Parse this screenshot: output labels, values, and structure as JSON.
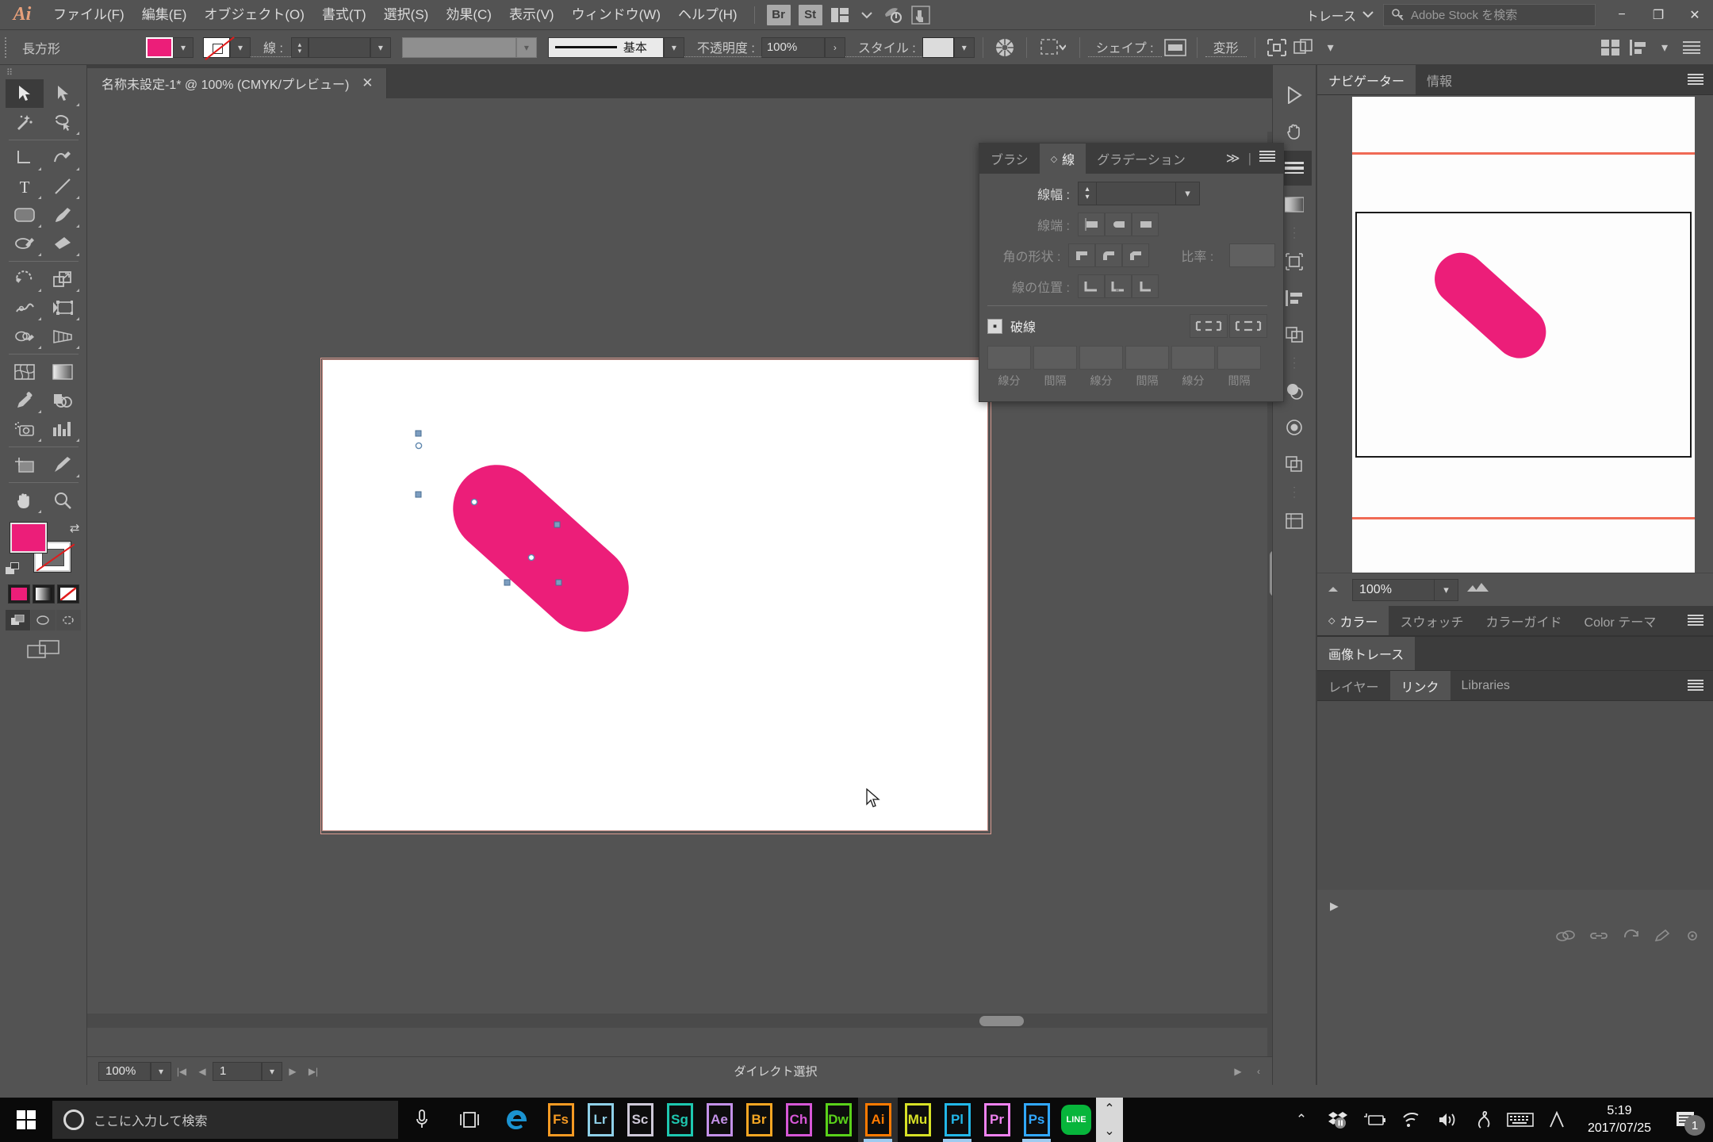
{
  "app": {
    "name": "Adobe Illustrator",
    "logo": "Ai"
  },
  "menubar": {
    "items": [
      {
        "label": "ファイル(F)"
      },
      {
        "label": "編集(E)"
      },
      {
        "label": "オブジェクト(O)"
      },
      {
        "label": "書式(T)"
      },
      {
        "label": "選択(S)"
      },
      {
        "label": "効果(C)"
      },
      {
        "label": "表示(V)"
      },
      {
        "label": "ウィンドウ(W)"
      },
      {
        "label": "ヘルプ(H)"
      }
    ],
    "bridge_label": "Br",
    "stock_label": "St",
    "workspace_label": "トレース",
    "search_placeholder": "Adobe Stock を検索",
    "window_minimize": "−",
    "window_restore": "❐",
    "window_close": "✕"
  },
  "controlbar": {
    "object_label": "長方形",
    "fill_color": "#ec1e79",
    "stroke_color": "none",
    "stroke_label": "線 :",
    "stroke_weight_value": "",
    "variable_width_value": "",
    "brush_label": "基本",
    "opacity_label": "不透明度 :",
    "opacity_value": "100%",
    "style_label": "スタイル :",
    "shape_label": "シェイプ :",
    "transform_label": "変形"
  },
  "toolbar": {
    "tools": [
      "selection-tool",
      "direct-selection-tool",
      "magic-wand-tool",
      "lasso-tool",
      "pen-tool",
      "curvature-tool",
      "type-tool",
      "line-segment-tool",
      "rectangle-tool",
      "paintbrush-tool",
      "shaper-tool",
      "eraser-tool",
      "rotate-tool",
      "scale-tool",
      "width-tool",
      "free-transform-tool",
      "shape-builder-tool",
      "perspective-grid-tool",
      "mesh-tool",
      "gradient-tool",
      "eyedropper-tool",
      "blend-tool",
      "symbol-sprayer-tool",
      "column-graph-tool",
      "artboard-tool",
      "slice-tool",
      "hand-tool",
      "zoom-tool"
    ],
    "fill_color": "#ec1e79",
    "stroke_color": "#ffffff",
    "active_tool": "selection-tool"
  },
  "document": {
    "tab_title": "名称未設定-1* @ 100% (CMYK/プレビュー)",
    "close_label": "✕",
    "artboard_bg": "#ffffff",
    "shape_color": "#ec1e79"
  },
  "statusbar": {
    "zoom_value": "100%",
    "artboard_number": "1",
    "status_text": "ダイレクト選択"
  },
  "stroke_panel": {
    "tabs": [
      {
        "label": "ブラシ",
        "active": false
      },
      {
        "label": "線",
        "active": true
      },
      {
        "label": "グラデーション",
        "active": false
      }
    ],
    "collapse_label": "≫",
    "weight_label": "線幅 :",
    "weight_value": "",
    "cap_label": "線端 :",
    "corner_label": "角の形状 :",
    "ratio_label": "比率 :",
    "ratio_value": "",
    "align_label": "線の位置 :",
    "dashed_label": "破線",
    "dashed_checked": true,
    "dash_fields": [
      {
        "label": "線分",
        "value": ""
      },
      {
        "label": "間隔",
        "value": ""
      },
      {
        "label": "線分",
        "value": ""
      },
      {
        "label": "間隔",
        "value": ""
      },
      {
        "label": "線分",
        "value": ""
      },
      {
        "label": "間隔",
        "value": ""
      }
    ]
  },
  "right_dock": {
    "nav_tabs": [
      {
        "label": "ナビゲーター",
        "active": true
      },
      {
        "label": "情報",
        "active": false
      }
    ],
    "nav_zoom_value": "100%",
    "color_tabs": [
      {
        "label": "カラー",
        "active": true
      },
      {
        "label": "スウォッチ",
        "active": false
      },
      {
        "label": "カラーガイド",
        "active": false
      },
      {
        "label": "Color テーマ",
        "active": false
      }
    ],
    "imagetrace_tab": "画像トレース",
    "layers_tabs": [
      {
        "label": "レイヤー",
        "active": false
      },
      {
        "label": "リンク",
        "active": true
      },
      {
        "label": "Libraries",
        "active": false
      }
    ]
  },
  "taskbar": {
    "search_placeholder": "ここに入力して検索",
    "apps": [
      {
        "code": "Fs",
        "color": "#f59a23"
      },
      {
        "code": "Lr",
        "color": "#8fd0e8"
      },
      {
        "code": "Sc",
        "color": "#cfc9d8"
      },
      {
        "code": "Sg",
        "color": "#1ec8b0"
      },
      {
        "code": "Ae",
        "color": "#c391e8"
      },
      {
        "code": "Br",
        "color": "#f5a623"
      },
      {
        "code": "Ch",
        "color": "#d657d6"
      },
      {
        "code": "Dw",
        "color": "#5ad11a"
      },
      {
        "code": "Ai",
        "color": "#ff7a00",
        "running": true
      },
      {
        "code": "Mu",
        "color": "#d6e026"
      },
      {
        "code": "Pl",
        "color": "#22b7e8"
      },
      {
        "code": "Pr",
        "color": "#ee82ee"
      },
      {
        "code": "Ps",
        "color": "#31a8ff"
      },
      {
        "code": "LINE",
        "color": "#07b53b"
      }
    ],
    "clock_time": "5:19",
    "clock_date": "2017/07/25",
    "notification_count": "1"
  }
}
